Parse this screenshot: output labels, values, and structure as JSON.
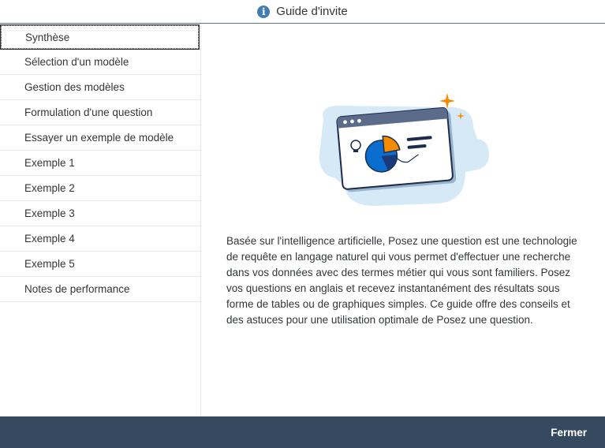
{
  "dialog": {
    "title": "Guide d'invite",
    "icon": "info-icon",
    "accent_color": "#427cac"
  },
  "sidebar": {
    "items": [
      {
        "label": "Synthèse",
        "selected": true
      },
      {
        "label": "Sélection d'un modèle",
        "selected": false
      },
      {
        "label": "Gestion des modèles",
        "selected": false
      },
      {
        "label": "Formulation d'une question",
        "selected": false
      },
      {
        "label": "Essayer un exemple de modèle",
        "selected": false
      },
      {
        "label": "Exemple 1",
        "selected": false
      },
      {
        "label": "Exemple 2",
        "selected": false
      },
      {
        "label": "Exemple 3",
        "selected": false
      },
      {
        "label": "Exemple 4",
        "selected": false
      },
      {
        "label": "Exemple 5",
        "selected": false
      },
      {
        "label": "Notes de performance",
        "selected": false
      }
    ]
  },
  "main": {
    "illustration": "analytics-window-illustration",
    "description": "Basée sur l'intelligence artificielle, Posez une question est une technologie de requête en langage naturel qui vous permet d'effectuer une recherche dans vos données avec des termes métier qui vous sont familiers. Posez vos questions en anglais et recevez instantanément des résultats sous forme de tables ou de graphiques simples. Ce guide offre des conseils et des astuces pour une utilisation optimale de Posez une question."
  },
  "footer": {
    "close_label": "Fermer",
    "background": "#354a5f"
  }
}
